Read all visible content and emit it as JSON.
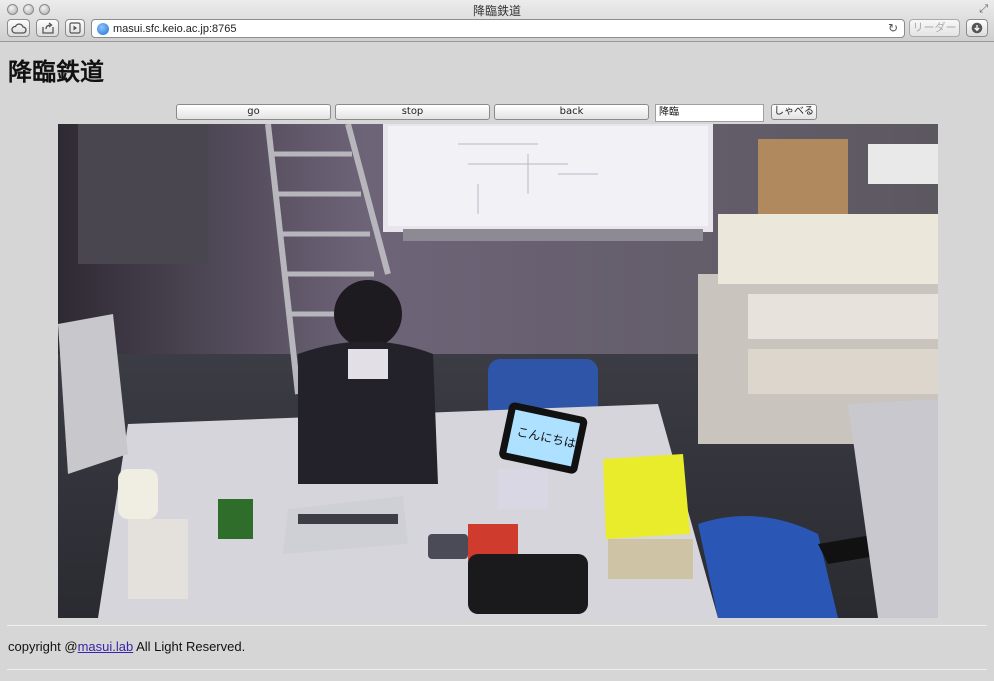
{
  "window": {
    "title": "降臨鉄道"
  },
  "toolbar": {
    "url": "masui.sfc.keio.ac.jp:8765",
    "reader_label": "リーダー"
  },
  "page": {
    "title": "降臨鉄道"
  },
  "controls": {
    "go_label": "go",
    "stop_label": "stop",
    "back_label": "back",
    "speak_value": "降臨",
    "speak_label": "しゃべる"
  },
  "camera": {
    "bubble_text": "こんにちは"
  },
  "footer": {
    "prefix": "copyright @",
    "link_text": "masui.lab",
    "suffix": " All Light Reserved."
  },
  "colors": {
    "link": "#3a25a8",
    "background": "#d6d6d6"
  }
}
